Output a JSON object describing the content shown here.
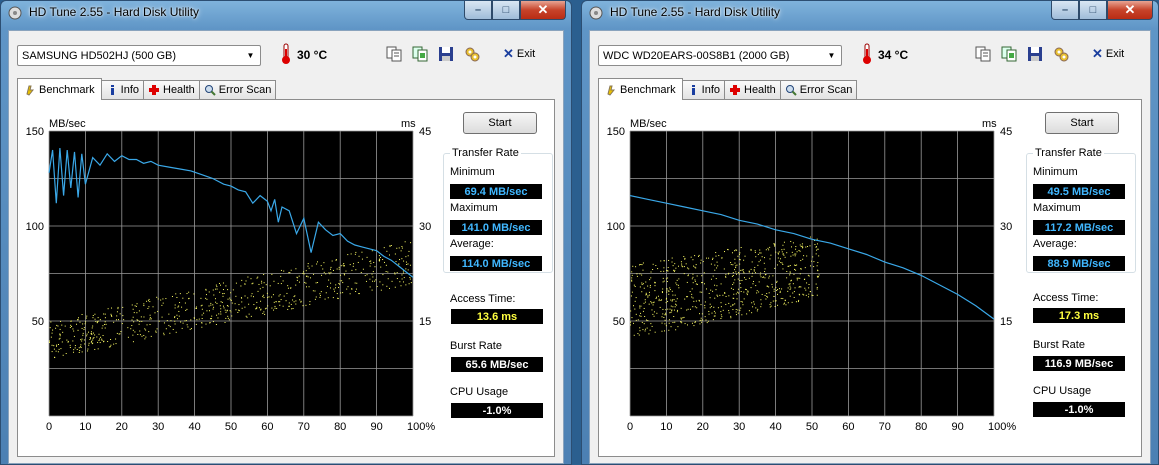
{
  "colors": {
    "transfer_line": "#3aa8e8",
    "access_dots": "#ffff66",
    "chart_bg": "#000000",
    "grid": "#9a9a9a"
  },
  "windows": [
    {
      "title": "HD Tune 2.55 - Hard Disk Utility",
      "drive": "SAMSUNG HD502HJ (500 GB)",
      "temperature": "30 °C",
      "exit_label": "Exit",
      "tabs": [
        "Benchmark",
        "Info",
        "Health",
        "Error Scan"
      ],
      "start_label": "Start",
      "transfer_rate_label": "Transfer Rate",
      "minimum_label": "Minimum",
      "minimum_value": "69.4 MB/sec",
      "maximum_label": "Maximum",
      "maximum_value": "141.0 MB/sec",
      "average_label": "Average:",
      "average_value": "114.0 MB/sec",
      "access_label": "Access Time:",
      "access_value": "13.6 ms",
      "burst_label": "Burst Rate",
      "burst_value": "65.6 MB/sec",
      "cpu_label": "CPU Usage",
      "cpu_value": "-1.0%"
    },
    {
      "title": "HD Tune 2.55 - Hard Disk Utility",
      "drive": "WDC WD20EARS-00S8B1 (2000 GB)",
      "temperature": "34 °C",
      "exit_label": "Exit",
      "tabs": [
        "Benchmark",
        "Info",
        "Health",
        "Error Scan"
      ],
      "start_label": "Start",
      "transfer_rate_label": "Transfer Rate",
      "minimum_label": "Minimum",
      "minimum_value": "49.5 MB/sec",
      "maximum_label": "Maximum",
      "maximum_value": "117.2 MB/sec",
      "average_label": "Average:",
      "average_value": "88.9 MB/sec",
      "access_label": "Access Time:",
      "access_value": "17.3 ms",
      "burst_label": "Burst Rate",
      "burst_value": "116.9 MB/sec",
      "cpu_label": "CPU Usage",
      "cpu_value": "-1.0%"
    }
  ],
  "chart_data": [
    {
      "type": "line",
      "ylabel": "MB/sec",
      "y2label": "ms",
      "x_ticks": [
        "0",
        "10",
        "20",
        "30",
        "40",
        "50",
        "60",
        "70",
        "80",
        "90",
        "100%"
      ],
      "y_ticks": [
        "150",
        "100",
        "50"
      ],
      "y2_ticks": [
        "45",
        "30",
        "15"
      ],
      "xlim": [
        0,
        100
      ],
      "ylim": [
        0,
        150
      ],
      "y2lim": [
        0,
        45
      ],
      "grid": true,
      "series": [
        {
          "values_x": [
            0,
            1,
            2,
            3,
            4,
            5,
            6,
            7,
            8,
            9,
            10,
            12,
            14,
            16,
            18,
            20,
            22,
            24,
            26,
            28,
            30,
            33,
            36,
            39,
            42,
            45,
            48,
            50,
            52,
            54,
            56,
            58,
            60,
            61,
            62,
            63,
            64,
            66,
            68,
            70,
            72,
            74,
            76,
            78,
            80,
            82,
            84,
            86,
            88,
            90,
            92,
            94,
            96,
            98,
            100
          ],
          "values_y": [
            128,
            140,
            112,
            141,
            116,
            140,
            120,
            139,
            115,
            138,
            122,
            136,
            132,
            138,
            134,
            137,
            135,
            135,
            133,
            134,
            132,
            131,
            130,
            129,
            127,
            125,
            122,
            121,
            119,
            118,
            112,
            116,
            113,
            108,
            114,
            102,
            110,
            108,
            96,
            104,
            86,
            102,
            98,
            95,
            96,
            92,
            90,
            89,
            88,
            87,
            84,
            82,
            79,
            76,
            73
          ]
        }
      ],
      "access_time_ms": {
        "start_range": [
          9,
          15
        ],
        "end_range": [
          21,
          28
        ]
      }
    },
    {
      "type": "line",
      "ylabel": "MB/sec",
      "y2label": "ms",
      "x_ticks": [
        "0",
        "10",
        "20",
        "30",
        "40",
        "50",
        "60",
        "70",
        "80",
        "90",
        "100%"
      ],
      "y_ticks": [
        "150",
        "100",
        "50"
      ],
      "y2_ticks": [
        "45",
        "30",
        "15"
      ],
      "xlim": [
        0,
        100
      ],
      "ylim": [
        0,
        150
      ],
      "y2lim": [
        0,
        45
      ],
      "grid": true,
      "series": [
        {
          "values_x": [
            0,
            5,
            10,
            15,
            20,
            25,
            30,
            35,
            40,
            45,
            50,
            55,
            60,
            65,
            70,
            75,
            80,
            85,
            90,
            95,
            100
          ],
          "values_y": [
            116,
            114,
            112,
            110,
            108,
            106,
            103,
            101,
            98,
            96,
            93,
            91,
            88,
            85,
            81,
            78,
            74,
            69,
            64,
            58,
            51
          ]
        }
      ],
      "access_time_ms": {
        "start_range": [
          12,
          24
        ],
        "end_range": [
          25,
          33
        ]
      }
    }
  ]
}
